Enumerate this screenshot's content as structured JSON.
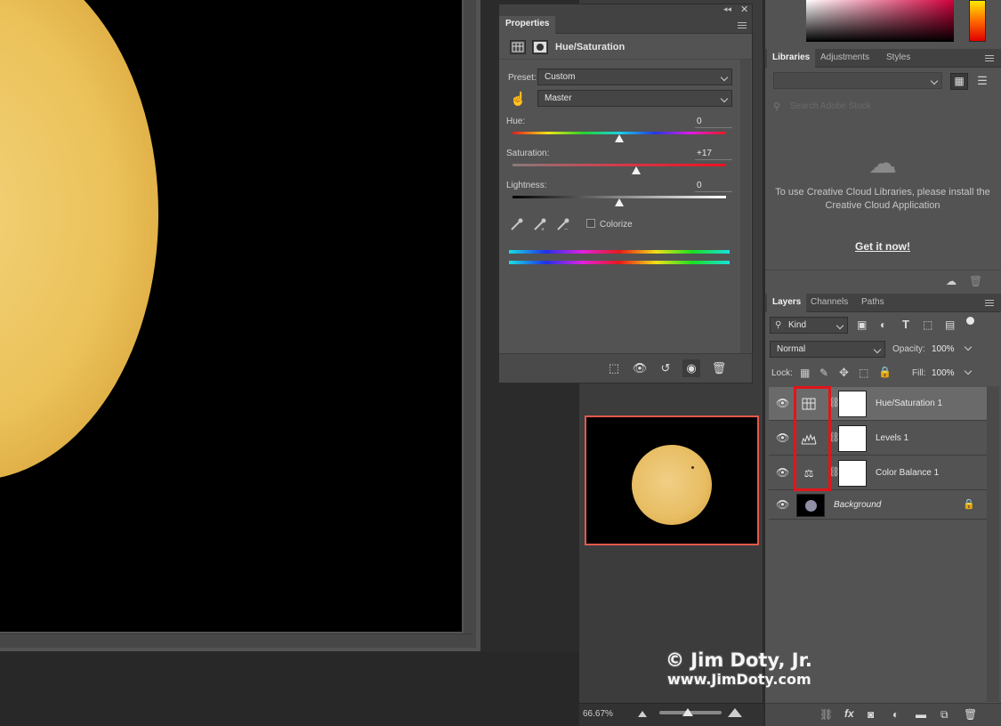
{
  "properties": {
    "tab_label": "Properties",
    "adjustment_title": "Hue/Saturation",
    "preset_label": "Preset:",
    "preset_value": "Custom",
    "channel_value": "Master",
    "hue": {
      "label": "Hue:",
      "value": "0",
      "level": 0.5
    },
    "saturation": {
      "label": "Saturation:",
      "value": "+17",
      "level": 0.58
    },
    "lightness": {
      "label": "Lightness:",
      "value": "0",
      "level": 0.5
    },
    "colorize_label": "Colorize"
  },
  "libraries": {
    "tabs": [
      "Libraries",
      "Adjustments",
      "Styles"
    ],
    "search_placeholder": "Search Adobe Stock",
    "message": "To use Creative Cloud Libraries, please install the Creative Cloud Application",
    "cta": "Get it now!"
  },
  "layers_panel": {
    "tabs": [
      "Layers",
      "Channels",
      "Paths"
    ],
    "filter_kind": "Kind",
    "blend_mode": "Normal",
    "opacity_label": "Opacity:",
    "opacity_value": "100%",
    "lock_label": "Lock:",
    "fill_label": "Fill:",
    "fill_value": "100%",
    "layers": [
      {
        "name": "Hue/Saturation 1",
        "icon": "hue-saturation-icon"
      },
      {
        "name": "Levels 1",
        "icon": "levels-icon"
      },
      {
        "name": "Color Balance 1",
        "icon": "color-balance-icon"
      },
      {
        "name": "Background",
        "icon": "background-thumbnail"
      }
    ]
  },
  "navigator": {
    "zoom": "66.67%"
  },
  "watermark": {
    "line1": "© Jim Doty, Jr.",
    "line2": "www.JimDoty.com"
  },
  "colors": {
    "highlight": "#e2141a",
    "navigator_border": "#e2594e",
    "panel": "#535353",
    "dark_panel": "#424242"
  }
}
